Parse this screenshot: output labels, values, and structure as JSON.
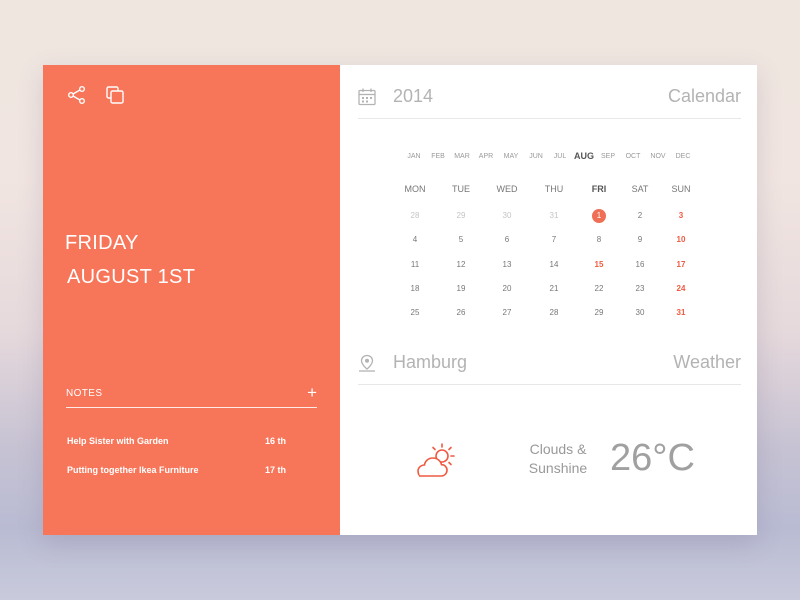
{
  "left": {
    "day": "FRIDAY",
    "date": "AUGUST 1ST",
    "notes_label": "NOTES",
    "add_symbol": "+",
    "notes": [
      {
        "title": "Help Sister with Garden",
        "day": "16 th"
      },
      {
        "title": "Putting together Ikea Furniture",
        "day": "17 th"
      }
    ],
    "accent_color": "#f77559"
  },
  "calendar": {
    "year": "2014",
    "title": "Calendar",
    "months": [
      "JAN",
      "FEB",
      "MAR",
      "APR",
      "MAY",
      "JUN",
      "JUL",
      "AUG",
      "SEP",
      "OCT",
      "NOV",
      "DEC"
    ],
    "active_month": "AUG",
    "weekdays": [
      "MON",
      "TUE",
      "WED",
      "THU",
      "FRI",
      "SAT",
      "SUN"
    ],
    "active_weekday": "FRI",
    "weeks": [
      [
        "28",
        "29",
        "30",
        "31",
        "1",
        "2",
        "3"
      ],
      [
        "4",
        "5",
        "6",
        "7",
        "8",
        "9",
        "10"
      ],
      [
        "11",
        "12",
        "13",
        "14",
        "15",
        "16",
        "17"
      ],
      [
        "18",
        "19",
        "20",
        "21",
        "22",
        "23",
        "24"
      ],
      [
        "25",
        "26",
        "27",
        "28",
        "29",
        "30",
        "31"
      ]
    ],
    "today": "1",
    "highlight_color": "#ef5a40"
  },
  "weather": {
    "city": "Hamburg",
    "title": "Weather",
    "condition_line1": "Clouds &",
    "condition_line2": "Sunshine",
    "temperature": "26°C",
    "icon": "cloud-sun-icon"
  }
}
